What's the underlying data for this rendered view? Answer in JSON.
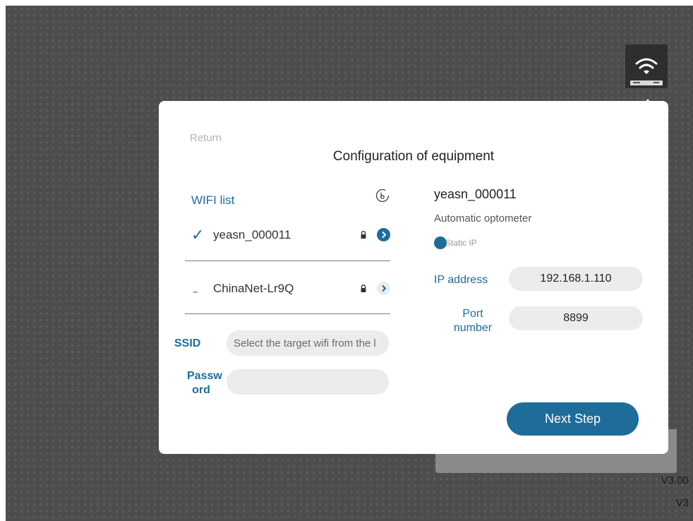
{
  "modal": {
    "return_label": "Return",
    "title": "Configuration of equipment",
    "wifi_list_title": "WIFI list",
    "networks": [
      {
        "name": "yeasn_000011",
        "selected": true
      },
      {
        "name": "ChinaNet-Lr9Q",
        "selected": false
      }
    ],
    "ssid_label": "SSID",
    "ssid_placeholder": "Select the target wifi from the l",
    "password_label": "Passw ord",
    "device": {
      "name": "yeasn_000011",
      "type": "Automatic optometer",
      "static_ip_label": "Static IP",
      "ip_label": "IP address",
      "ip_value": "192.168.1.110",
      "port_label": "Port number",
      "port_value": "8899"
    },
    "next_button": "Next Step"
  },
  "footer": {
    "version_1": "V3.00",
    "version_2": "V3"
  },
  "colors": {
    "accent": "#1e6c99",
    "background": "#4d4d4d"
  },
  "icons": {
    "device": "wifi-router-icon",
    "refresh": "refresh-icon",
    "check": "check-icon",
    "lock": "lock-icon",
    "go": "chevron-right-icon"
  }
}
